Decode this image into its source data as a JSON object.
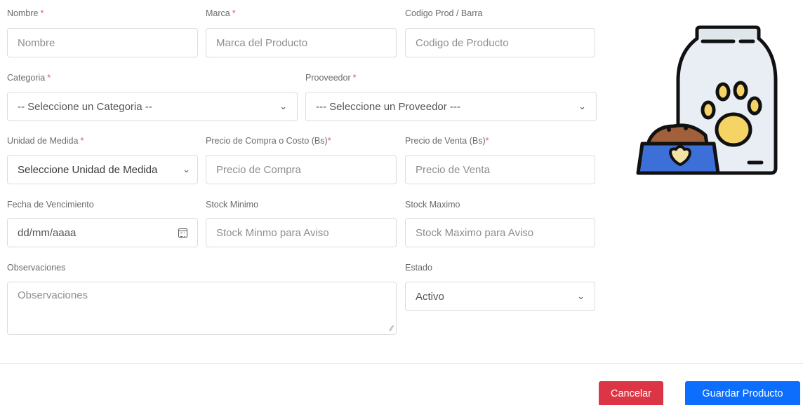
{
  "form": {
    "nombre": {
      "label": "Nombre",
      "required": "*",
      "placeholder": "Nombre"
    },
    "marca": {
      "label": "Marca",
      "required": "*",
      "placeholder": "Marca del Producto"
    },
    "codigo": {
      "label": "Codigo Prod / Barra",
      "placeholder": "Codigo de Producto"
    },
    "categoria": {
      "label": "Categoria",
      "required": "*",
      "selected": "-- Seleccione un Categoria --"
    },
    "proveedor": {
      "label": "Prooveedor",
      "required": "*",
      "selected": "--- Seleccione un Proveedor ---"
    },
    "unidad": {
      "label": "Unidad de Medida",
      "required": "*",
      "selected": "Seleccione Unidad de Medida"
    },
    "precio_compra": {
      "label": "Precio de Compra o Costo (Bs)",
      "required": "*",
      "placeholder": "Precio de Compra"
    },
    "precio_venta": {
      "label": "Precio de Venta (Bs)",
      "required": "*",
      "placeholder": "Precio de Venta"
    },
    "fecha": {
      "label": "Fecha de Vencimiento",
      "placeholder": "dd/mm/aaaa"
    },
    "stock_min": {
      "label": "Stock Minimo",
      "placeholder": "Stock Minmo para Aviso"
    },
    "stock_max": {
      "label": "Stock Maximo",
      "placeholder": "Stock Maximo para Aviso"
    },
    "observaciones": {
      "label": "Observaciones",
      "placeholder": "Observaciones"
    },
    "estado": {
      "label": "Estado",
      "selected": "Activo"
    }
  },
  "icons": {
    "chevron": "chevron-down-icon",
    "calendar": "calendar-icon",
    "resize": "resize-grip-icon",
    "illustration": "pet-food-bag-illustration"
  },
  "actions": {
    "cancel_label": "Cancelar",
    "save_label": "Guardar Producto"
  },
  "colors": {
    "cancel": "#dc3545",
    "save": "#0d6efd",
    "required": "#e05a5a"
  }
}
